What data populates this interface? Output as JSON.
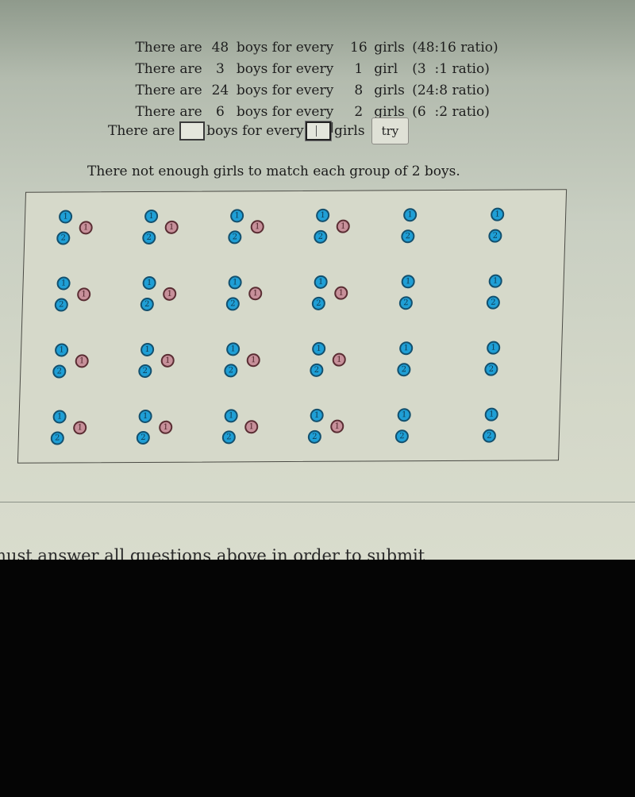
{
  "ratio_statements": [
    {
      "prefix": "There are",
      "boys": "48",
      "middle": "boys for every",
      "girls": "16",
      "unit": "girls",
      "ratio": "(48:16 ratio)"
    },
    {
      "prefix": "There are",
      "boys": "3",
      "middle": "boys for every",
      "girls": "1",
      "unit": "girl",
      "ratio": "(3  :1 ratio)"
    },
    {
      "prefix": "There are",
      "boys": "24",
      "middle": "boys for every",
      "girls": "8",
      "unit": "girls",
      "ratio": "(24:8 ratio)"
    },
    {
      "prefix": "There are",
      "boys": "6",
      "middle": "boys for every",
      "girls": "2",
      "unit": "girls",
      "ratio": "(6  :2 ratio)"
    }
  ],
  "answer": {
    "prefix": "There are",
    "boys_value": "",
    "middle": "boys for every",
    "girls_value": "",
    "suffix": "girls",
    "try_label": "try"
  },
  "feedback_message": "There not enough girls to match each group of 2 boys.",
  "grid": {
    "rows": 4,
    "columns": 6,
    "boys_per_group": 2,
    "groups_with_girl_per_row": 4,
    "boy_labels": [
      "1",
      "2"
    ],
    "girl_label": "1",
    "colors": {
      "boy": "#1f9fd6",
      "girl": "#c7909a"
    }
  },
  "footer_text": "must answer all questions above in order to submit"
}
